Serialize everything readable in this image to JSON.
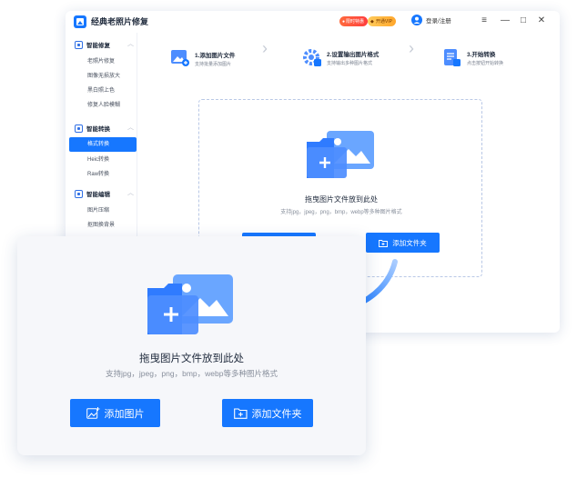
{
  "app": {
    "title": "经典老照片修复",
    "badge_promo": "限时特惠",
    "badge_vip": "开通VIP",
    "login_label": "登录/注册"
  },
  "sidebar": {
    "groups": [
      {
        "label": "智能修复",
        "items": [
          "老照片修复",
          "图像无损放大",
          "黑白照上色",
          "修复人脸模糊"
        ]
      },
      {
        "label": "智能转换",
        "items": [
          "格式转换",
          "Heic转换",
          "Raw转换"
        ]
      },
      {
        "label": "智能编辑",
        "items": [
          "图片压缩",
          "抠图换背景"
        ]
      }
    ],
    "active_item": "格式转换"
  },
  "steps": [
    {
      "title": "1.添加图片文件",
      "sub": "支持批量添加图片"
    },
    {
      "title": "2.设置输出图片格式",
      "sub": "支持输出多种图片格式"
    },
    {
      "title": "3.开始转换",
      "sub": "点击按钮开始转换"
    }
  ],
  "drop": {
    "title": "拖曳图片文件放到此处",
    "sub": "支持jpg，jpeg，png，bmp，webp等多种图片格式",
    "add_image": "添加图片",
    "add_folder": "添加文件夹"
  },
  "colors": {
    "accent": "#1677ff",
    "dashed": "#b9c8e6"
  }
}
